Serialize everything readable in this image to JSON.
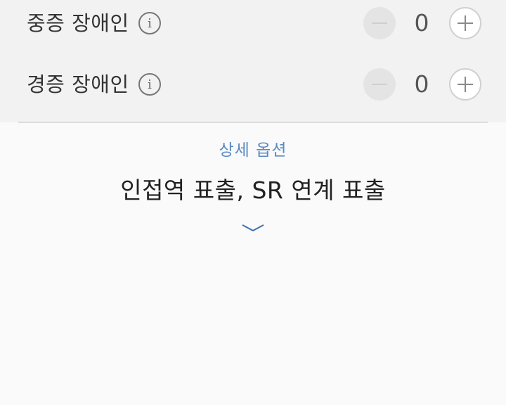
{
  "passengers": [
    {
      "label": "중증 장애인",
      "count": "0"
    },
    {
      "label": "경증 장애인",
      "count": "0"
    }
  ],
  "icons": {
    "info": "i",
    "minus": "minus-icon",
    "plus": "plus-icon",
    "expand": "chevron-down-icon"
  },
  "details": {
    "title": "상세 옵션",
    "summary": "인접역 표출, SR 연계 표출"
  },
  "colors": {
    "panel_bg": "#f2f2f2",
    "page_bg": "#fafafa",
    "accent": "#5a8ac0",
    "text": "#333333"
  }
}
